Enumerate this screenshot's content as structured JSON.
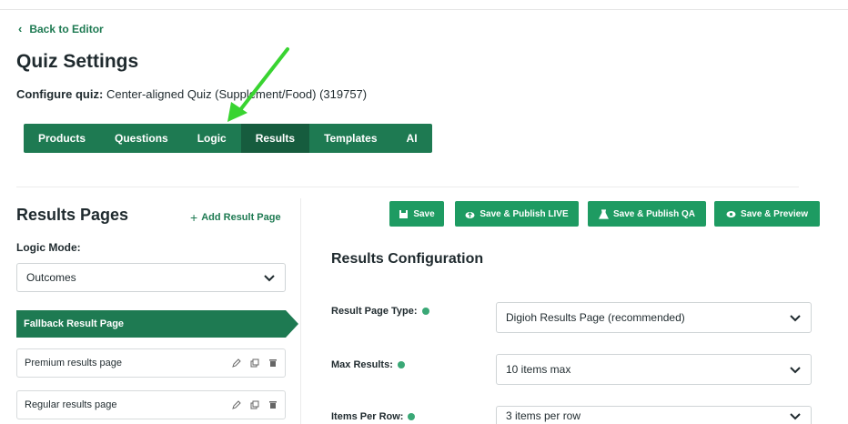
{
  "nav": {
    "back_label": "Back to Editor"
  },
  "header": {
    "title": "Quiz Settings",
    "configure_label": "Configure quiz:",
    "configure_value": "Center-aligned Quiz (Supplement/Food) (319757)"
  },
  "tabs": [
    {
      "label": "Products"
    },
    {
      "label": "Questions"
    },
    {
      "label": "Logic"
    },
    {
      "label": "Results",
      "active": true
    },
    {
      "label": "Templates"
    },
    {
      "label": "AI"
    }
  ],
  "sidebar": {
    "title": "Results Pages",
    "add_label": "Add Result Page",
    "logic_mode_label": "Logic Mode:",
    "logic_mode_value": "Outcomes",
    "items": [
      {
        "label": "Fallback Result Page",
        "active": true
      },
      {
        "label": "Premium results page"
      },
      {
        "label": "Regular results page"
      }
    ]
  },
  "toolbar": {
    "save": "Save",
    "publish_live": "Save & Publish LIVE",
    "publish_qa": "Save & Publish QA",
    "preview": "Save & Preview"
  },
  "config": {
    "title": "Results Configuration",
    "fields": [
      {
        "label": "Result Page Type:",
        "value": "Digioh Results Page (recommended)"
      },
      {
        "label": "Max Results:",
        "value": "10 items max"
      },
      {
        "label": "Items Per Row:",
        "value": "3 items per row"
      }
    ]
  },
  "colors": {
    "brand_green": "#1e7a52",
    "button_green": "#1e9b62",
    "arrow_green": "#39d431"
  }
}
